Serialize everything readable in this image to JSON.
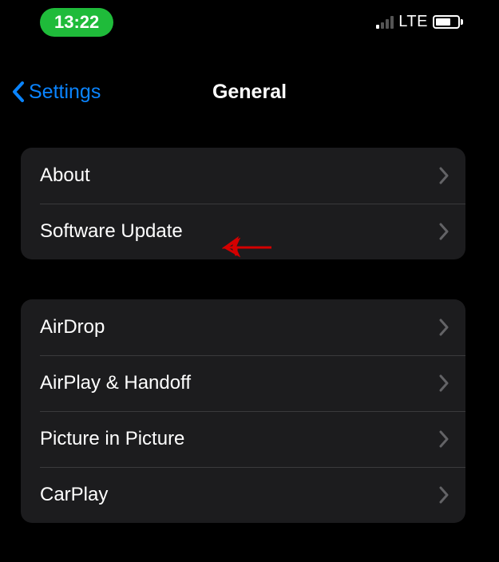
{
  "status_bar": {
    "time": "13:22",
    "network": "LTE"
  },
  "nav": {
    "back_label": "Settings",
    "title": "General"
  },
  "groups": [
    {
      "id": "top",
      "rows": [
        {
          "id": "about",
          "label": "About"
        },
        {
          "id": "software-update",
          "label": "Software Update"
        }
      ]
    },
    {
      "id": "mid",
      "rows": [
        {
          "id": "airdrop",
          "label": "AirDrop"
        },
        {
          "id": "airplay-handoff",
          "label": "AirPlay & Handoff"
        },
        {
          "id": "picture-in-picture",
          "label": "Picture in Picture"
        },
        {
          "id": "carplay",
          "label": "CarPlay"
        }
      ]
    }
  ]
}
